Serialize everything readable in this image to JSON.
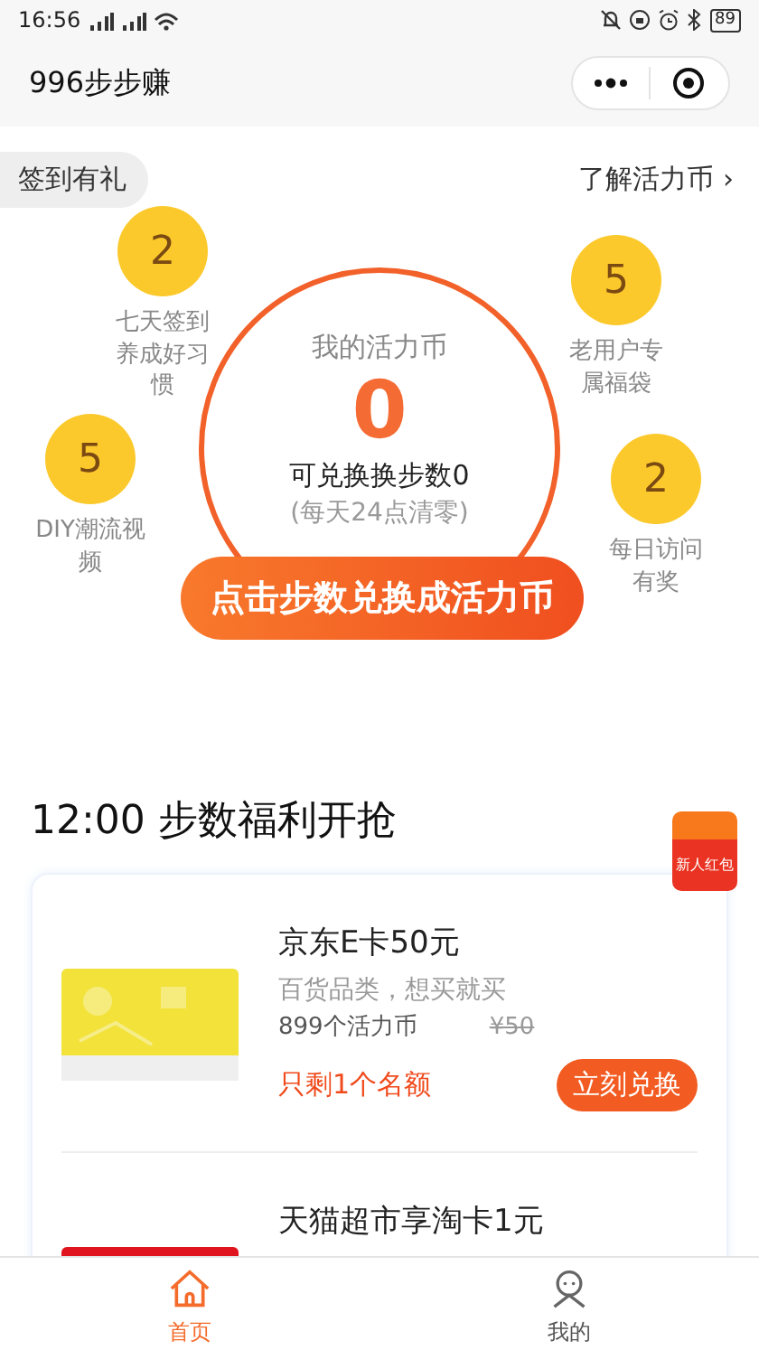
{
  "status_bar": {
    "time": "16:56",
    "battery": "89"
  },
  "nav": {
    "title": "996步步赚"
  },
  "checkin": "签到有礼",
  "learn_link": {
    "label": "了解活力币",
    "arrow": "›"
  },
  "bubbles": [
    {
      "value": "2",
      "label": "七天签到养成好习惯"
    },
    {
      "value": "5",
      "label": "DIY潮流视频"
    },
    {
      "value": "5",
      "label": "老用户专属福袋"
    },
    {
      "value": "2",
      "label": "每日访问有奖"
    }
  ],
  "coin": {
    "label": "我的活力币",
    "amount": "0",
    "steps": "可兑换换步数0",
    "note": "(每天24点清零)"
  },
  "exchange_button": "点击步数兑换成活力币",
  "section_title": "12:00 步数福利开抢",
  "red_packet": "新人红包",
  "products": [
    {
      "title": "京东E卡50元",
      "subtitle": "百货品类，想买就买",
      "price": "899个活力币",
      "original_price": "¥50",
      "stock": "只剩1个名额",
      "button": "立刻兑换"
    },
    {
      "title": "天猫超市享淘卡1元"
    }
  ],
  "tabs": [
    {
      "label": "首页",
      "selected": true
    },
    {
      "label": "我的",
      "selected": false
    }
  ]
}
